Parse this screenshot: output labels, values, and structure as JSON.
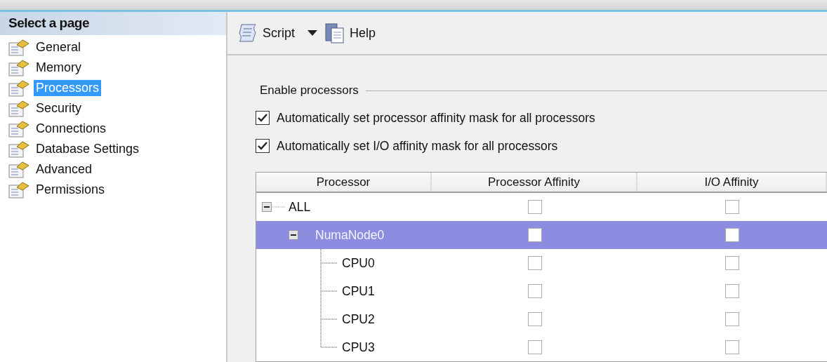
{
  "sidebar": {
    "title": "Select a page",
    "items": [
      {
        "label": "General",
        "selected": false
      },
      {
        "label": "Memory",
        "selected": false
      },
      {
        "label": "Processors",
        "selected": true
      },
      {
        "label": "Security",
        "selected": false
      },
      {
        "label": "Connections",
        "selected": false
      },
      {
        "label": "Database Settings",
        "selected": false
      },
      {
        "label": "Advanced",
        "selected": false
      },
      {
        "label": "Permissions",
        "selected": false
      }
    ]
  },
  "toolbar": {
    "script": "Script",
    "help": "Help"
  },
  "group": {
    "title": "Enable processors",
    "options": [
      {
        "label": "Automatically set processor affinity mask for all processors",
        "checked": true
      },
      {
        "label": "Automatically set I/O affinity mask for all processors",
        "checked": true
      }
    ]
  },
  "grid": {
    "columns": [
      "Processor",
      "Processor Affinity",
      "I/O Affinity"
    ],
    "rows": [
      {
        "name": "ALL",
        "expanded": true,
        "selected": false,
        "processor_affinity": false,
        "io_affinity": false,
        "children": [
          {
            "name": "NumaNode0",
            "expanded": true,
            "selected": true,
            "processor_affinity": false,
            "io_affinity": false,
            "children": [
              {
                "name": "CPU0",
                "selected": false,
                "processor_affinity": false,
                "io_affinity": false
              },
              {
                "name": "CPU1",
                "selected": false,
                "processor_affinity": false,
                "io_affinity": false
              },
              {
                "name": "CPU2",
                "selected": false,
                "processor_affinity": false,
                "io_affinity": false
              },
              {
                "name": "CPU3",
                "selected": false,
                "processor_affinity": false,
                "io_affinity": false
              }
            ]
          }
        ]
      }
    ]
  }
}
